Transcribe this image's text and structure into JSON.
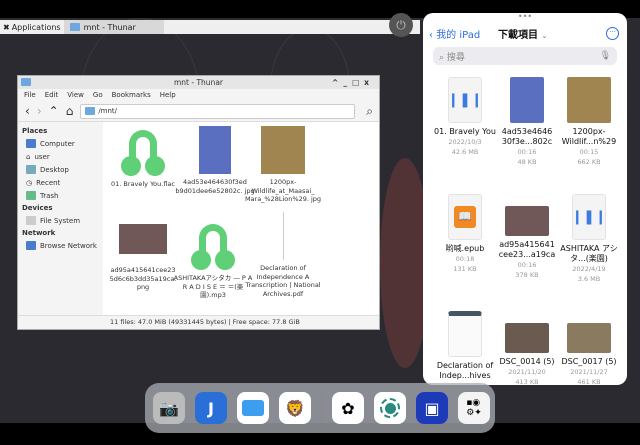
{
  "panel": {
    "applications": "Applications",
    "task": "mnt - Thunar"
  },
  "thunar": {
    "title": "mnt - Thunar",
    "menu": [
      "File",
      "Edit",
      "View",
      "Go",
      "Bookmarks",
      "Help"
    ],
    "path": "/mnt/",
    "sidebar": {
      "places": "Places",
      "places_items": [
        "Computer",
        "user",
        "Desktop",
        "Recent",
        "Trash"
      ],
      "devices": "Devices",
      "devices_items": [
        "File System"
      ],
      "network": "Network",
      "network_items": [
        "Browse Network"
      ]
    },
    "files": [
      "01. Bravely You.flac",
      "4ad53e464630f3ed b9d01dee6e52802c. jpg",
      "1200px- Wildlife_at_Maasai_ Mara_%28Lion%29. jpg",
      "ad95a415641cee23 5d6c6b3dd35a19ca. png",
      "ASHITAKAアシタカ ― P A R A D I S E ＝ ＝(楽園).mp3",
      "Declaration of Independence A Transcription | National Archives.pdf"
    ],
    "status": "11 files: 47.0 MiB (49331445 bytes)  |  Free space: 77.8 GiB"
  },
  "ipad": {
    "back": "我的 iPad",
    "title": "下載項目",
    "search_placeholder": "搜尋",
    "items": [
      {
        "name": "01. Bravely You",
        "date": "2022/10/3",
        "size": "42.6 MB"
      },
      {
        "name": "4ad53e4646 30f3e...802c",
        "date": "00:16",
        "size": "48 KB"
      },
      {
        "name": "1200px- Wildlif...n%29",
        "date": "00:15",
        "size": "662 KB"
      },
      {
        "name": "哟喊.epub",
        "date": "00:18",
        "size": "131 KB"
      },
      {
        "name": "ad95a415641 cee23...a19ca",
        "date": "00:16",
        "size": "378 KB"
      },
      {
        "name": "ASHITAKA アシタ...(楽園)",
        "date": "2022/4/19",
        "size": "3.6 MB"
      },
      {
        "name": "Declaration of Indep...hives",
        "date": "",
        "size": ""
      },
      {
        "name": "DSC_0014 (5)",
        "date": "2021/11/20",
        "size": "413 KB"
      },
      {
        "name": "DSC_0017 (5)",
        "date": "2021/11/27",
        "size": "461 KB"
      }
    ]
  },
  "dock": [
    "camera",
    "jellyfin",
    "files",
    "brave",
    "photos",
    "screen-record",
    "lens",
    "app-library"
  ]
}
